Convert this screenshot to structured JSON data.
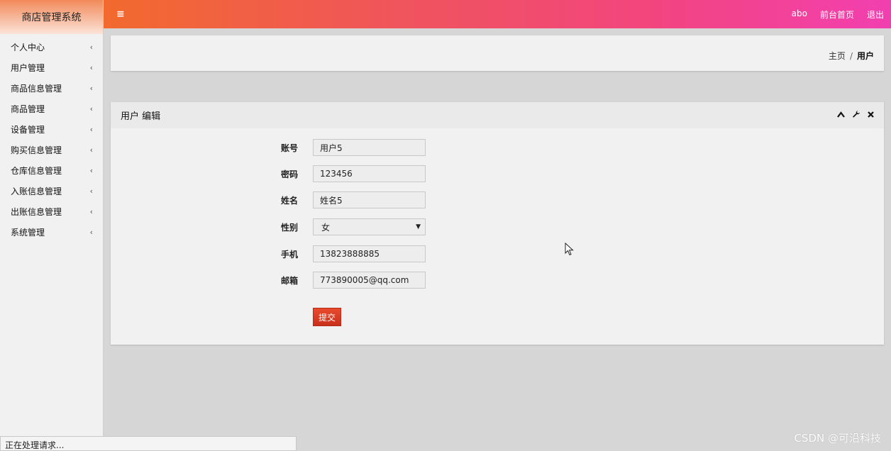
{
  "app": {
    "title": "商店管理系统"
  },
  "sidebar": {
    "items": [
      {
        "label": "个人中心"
      },
      {
        "label": "用户管理"
      },
      {
        "label": "商品信息管理"
      },
      {
        "label": "商品管理"
      },
      {
        "label": "设备管理"
      },
      {
        "label": "购买信息管理"
      },
      {
        "label": "仓库信息管理"
      },
      {
        "label": "入账信息管理"
      },
      {
        "label": "出账信息管理"
      },
      {
        "label": "系统管理"
      }
    ],
    "chevron": "‹"
  },
  "topbar": {
    "menu_icon": "≡",
    "user": "abo",
    "home_link": "前台首页",
    "logout": "退出",
    "gradient": [
      "#f26a2e",
      "#f23fb0"
    ]
  },
  "breadcrumb": {
    "home": "主页",
    "separator": "/",
    "current": "用户"
  },
  "panel": {
    "title": "用户 编辑",
    "tools": {
      "collapse": "⌃",
      "settings": "🔧",
      "close": "✖"
    }
  },
  "form": {
    "fields": [
      {
        "label": "账号",
        "value": "用户5"
      },
      {
        "label": "密码",
        "value": "123456"
      },
      {
        "label": "姓名",
        "value": "姓名5"
      },
      {
        "label": "性别",
        "value": "女"
      },
      {
        "label": "手机",
        "value": "13823888885"
      },
      {
        "label": "邮箱",
        "value": "773890005@qq.com"
      }
    ],
    "select_arrow": "▼",
    "submit_label": "提交"
  },
  "status": {
    "text": "正在处理请求..."
  },
  "watermark": "CSDN @可沿科技",
  "colors": {
    "accent": "#d63a22",
    "sidebar_bg": "#f2f1f2",
    "page_bg": "#d6d6d6"
  }
}
